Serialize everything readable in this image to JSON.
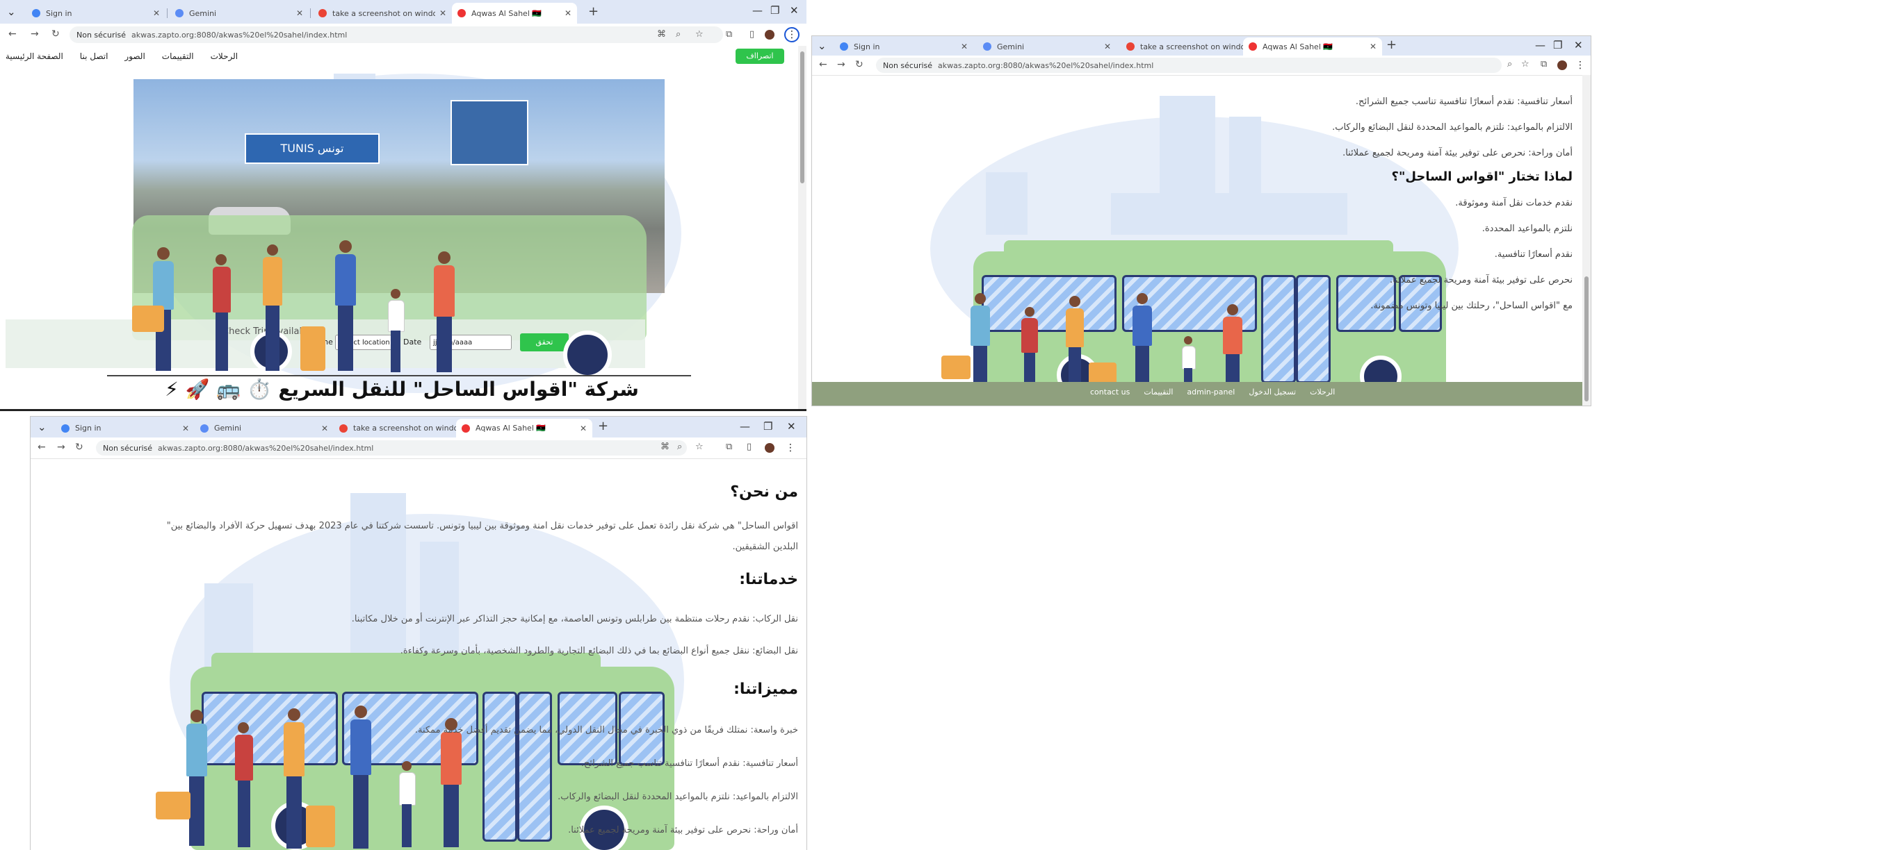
{
  "browser": {
    "tabs": [
      "Sign in",
      "Gemini",
      "take a screenshot on windows",
      "Aqwas Al Sahel 🇱🇾"
    ],
    "security_label": "Non sécurisé",
    "url_short": "akwas.zapto.org:8080/akwas%20el%20sahel/index.html",
    "url_long": "akwas.zapto.org:8080/akwas%20el%20sahel/index.html",
    "new_tab": "+"
  },
  "window1": {
    "login_button": "اتصرااف",
    "nav": [
      "الصفحة الرئيسية",
      "اتصل بنا",
      "الصور",
      "التقييمات",
      "الرحلات"
    ],
    "checker": {
      "title": "Check Trip Availability",
      "line_label": "Line",
      "line_placeholder": "Select location",
      "date_label": "Date",
      "date_placeholder": "jj/mm/aaaa",
      "submit": "تحقق"
    },
    "headline": "شركة \"اقواس الساحل\" للنقل السريع ⏱️ 🚌 🚀 ⚡",
    "sign_text": "TUNIS تونس"
  },
  "window2": {
    "lines": [
      "أسعار تنافسية: نقدم أسعارًا تنافسية تناسب جميع الشرائح.",
      "الالتزام بالمواعيد: نلتزم بالمواعيد المحددة لنقل البضائع والركاب.",
      "أمان وراحة: نحرص على توفير بيئة آمنة ومريحة لجميع عملائنا."
    ],
    "why_heading": "لماذا تختار \"اقواس الساحل\"؟",
    "why_lines": [
      "نقدم خدمات نقل آمنة وموثوقة.",
      "نلتزم بالمواعيد المحددة.",
      "نقدم أسعارًا تنافسية.",
      "نحرص على توفير بيئة آمنة ومريحة لجميع عملائنا.",
      "مع \"اقواس الساحل\"، رحلتك بين ليبيا وتونس مضمونة."
    ],
    "footer_links": [
      "الرحلات",
      "تسجيل الدخول",
      "admin-panel",
      "التقييمات",
      "contact us"
    ]
  },
  "window3": {
    "about_heading": "من نحن؟",
    "about_line1": "اقواس الساحل\" هي شركة نقل رائدة تعمل على توفير خدمات نقل آمنة وموثوقة بين ليبيا وتونس. تأسست شركتنا في عام 2023 بهدف تسهيل حركة الأفراد والبضائع بين\"",
    "about_line2": "البلدين الشقيقين.",
    "services_heading": "خدماتنا:",
    "services": [
      "نقل الركاب: نقدم رحلات منتظمة بين طرابلس وتونس العاصمة، مع إمكانية حجز التذاكر عبر الإنترنت أو من خلال مكاتبنا.",
      "نقل البضائع: ننقل جميع أنواع البضائع بما في ذلك البضائع التجارية والطرود الشخصية، بأمان وسرعة وكفاءة."
    ],
    "features_heading": "مميزاتنا:",
    "features": [
      "خبرة واسعة: نمتلك فريقًا من ذوي الخبرة في مجال النقل الدولي، مما يضمن تقديم أفضل خدمة ممكنة.",
      "أسعار تنافسية: نقدم أسعارًا تنافسية تناسب جميع الشرائح.",
      "الالتزام بالمواعيد: نلتزم بالمواعيد المحددة لنقل البضائع والركاب.",
      "أمان وراحة: نحرص على توفير بيئة آمنة ومريحة لجميع عملائنا."
    ]
  },
  "colors": {
    "tabbar": "#dfe7f6",
    "bus_green": "#a9d89b",
    "accent_green": "#2fc44c",
    "footer_green": "#8fa07e"
  }
}
